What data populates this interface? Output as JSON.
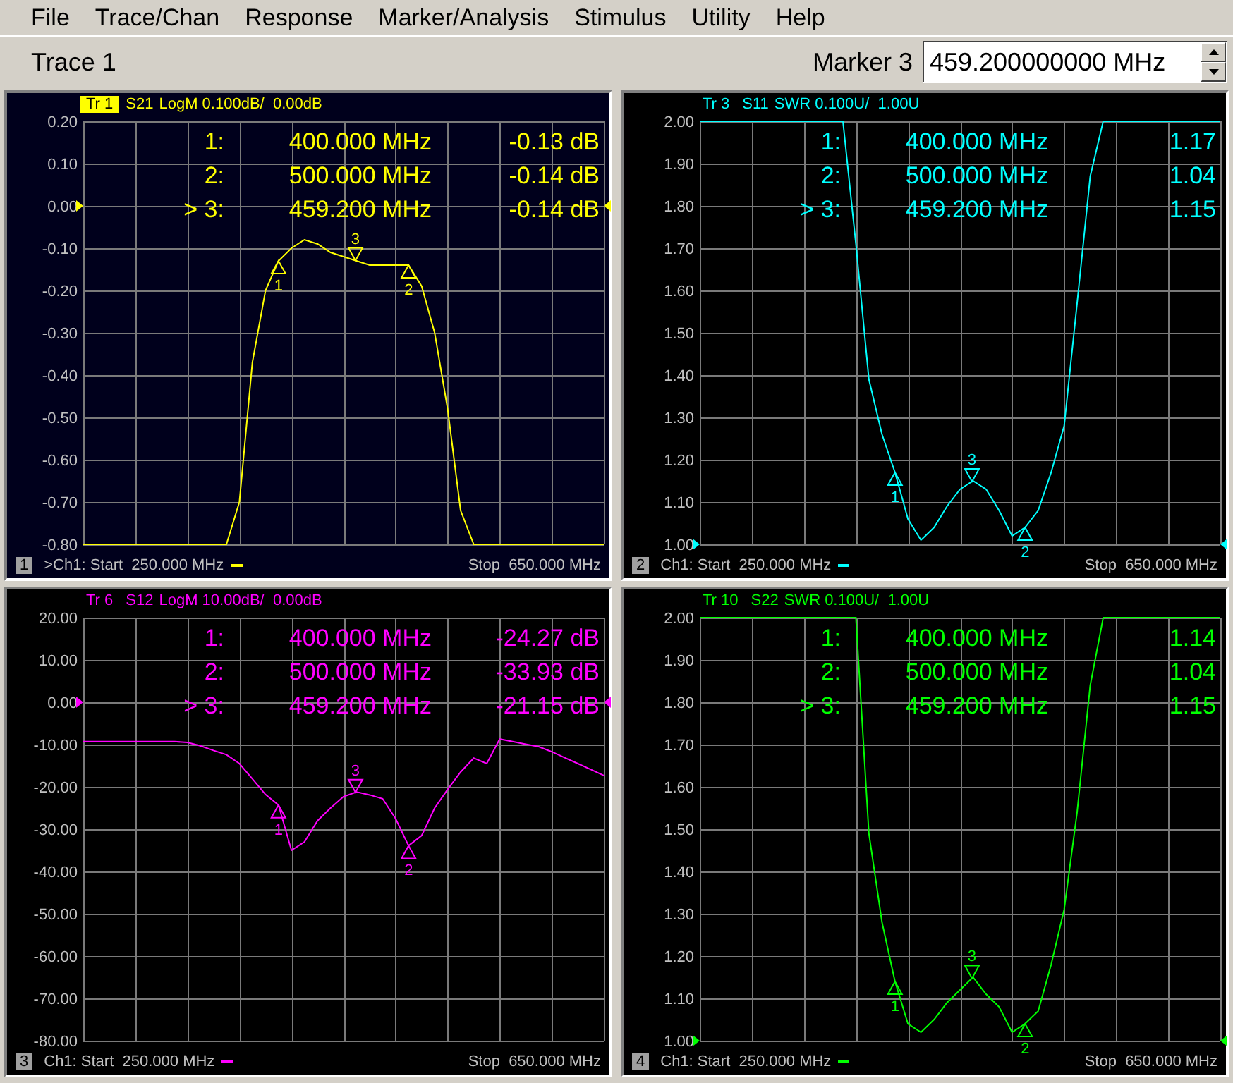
{
  "menu": [
    "File",
    "Trace/Chan",
    "Response",
    "Marker/Analysis",
    "Stimulus",
    "Utility",
    "Help"
  ],
  "toolbar": {
    "trace": "Trace 1",
    "marker_label": "Marker 3",
    "marker_value": "459.200000000 MHz"
  },
  "panels": [
    {
      "number": "1",
      "selected": true,
      "trace_label": "Tr 1",
      "format": "LogM 0.100dB/  0.00dB",
      "chart_data": {
        "type": "line",
        "categories": [
          null,
          null,
          null,
          null,
          null,
          null,
          null,
          null,
          null,
          null,
          null,
          null,
          null,
          null,
          null,
          null,
          null,
          null,
          null,
          null,
          null,
          null,
          null,
          null,
          null,
          null,
          null,
          null,
          null,
          null,
          null,
          null,
          null,
          null,
          null,
          null,
          null,
          null,
          null,
          null,
          null
        ],
        "series": [
          {
            "name": "S21",
            "color": "#ffff00",
            "values": [
              -0.8,
              -0.8,
              -0.8,
              -0.8,
              -0.8,
              -0.8,
              -0.8,
              -0.8,
              -0.8,
              -0.8,
              -0.8,
              -0.8,
              -0.7,
              -0.37,
              -0.2,
              -0.13,
              -0.1,
              -0.08,
              -0.09,
              -0.11,
              -0.12,
              -0.13,
              -0.14,
              -0.14,
              -0.14,
              -0.14,
              -0.19,
              -0.3,
              -0.48,
              -0.72,
              -0.8,
              -0.8,
              -0.8,
              -0.8,
              -0.8,
              -0.8,
              -0.8,
              -0.8,
              -0.8,
              -0.8,
              -0.8
            ]
          }
        ],
        "grid": true,
        "ylim": [
          -0.8,
          0.2
        ],
        "yticks": [
          {
            "value": 0.2,
            "label": "0.20"
          },
          {
            "value": 0.1,
            "label": "0.10"
          },
          {
            "value": 0,
            "label": "0.00"
          },
          {
            "value": -0.1,
            "label": "-0.10"
          },
          {
            "value": -0.2,
            "label": "-0.20"
          },
          {
            "value": -0.3,
            "label": "-0.30"
          },
          {
            "value": -0.4,
            "label": "-0.40"
          },
          {
            "value": -0.5,
            "label": "-0.50"
          },
          {
            "value": -0.6,
            "label": "-0.60"
          },
          {
            "value": -0.7,
            "label": "-0.70"
          },
          {
            "value": -0.8,
            "label": "-0.80"
          }
        ]
      },
      "readouts": [
        {
          "label": "1:",
          "freq": "400.000 MHz",
          "value": "-0.13 dB"
        },
        {
          "label": "2:",
          "freq": "500.000 MHz",
          "value": "-0.14 dB"
        },
        {
          "label": "> 3:",
          "freq": "459.200 MHz",
          "value": "-0.14 dB"
        }
      ],
      "plot_markers": [
        {
          "label": "1",
          "kind": "up"
        },
        {
          "label": "2",
          "kind": "up"
        },
        {
          "label": "3",
          "kind": "down"
        }
      ],
      "start": ">Ch1: Start  250.000 MHz",
      "stop": "Stop  650.000 MHz"
    },
    {
      "number": "2",
      "selected": false,
      "trace_label": "Tr 3",
      "format": "SWR 0.100U/  1.00U",
      "chart_data": {
        "type": "line",
        "categories": [
          null,
          null,
          null,
          null,
          null,
          null,
          null,
          null,
          null,
          null,
          null,
          null,
          null,
          null,
          null,
          null,
          null,
          null,
          null,
          null,
          null,
          null,
          null,
          null,
          null,
          null,
          null,
          null,
          null,
          null,
          null,
          null,
          null,
          null,
          null,
          null,
          null,
          null,
          null,
          null,
          null
        ],
        "series": [
          {
            "name": "S11",
            "color": "#00ffff",
            "values": [
              2,
              2,
              2,
              2,
              2,
              2,
              2,
              2,
              2,
              2,
              2,
              2,
              1.71,
              1.39,
              1.26,
              1.17,
              1.06,
              1.01,
              1.04,
              1.09,
              1.13,
              1.15,
              1.13,
              1.08,
              1.02,
              1.04,
              1.08,
              1.17,
              1.28,
              1.57,
              1.87,
              2,
              2,
              2,
              2,
              2,
              2,
              2,
              2,
              2,
              2
            ]
          }
        ],
        "grid": true,
        "ylim": [
          1,
          2
        ],
        "yticks": [
          {
            "value": 2,
            "label": "2.00"
          },
          {
            "value": 1.9,
            "label": "1.90"
          },
          {
            "value": 1.8,
            "label": "1.80"
          },
          {
            "value": 1.7,
            "label": "1.70"
          },
          {
            "value": 1.6,
            "label": "1.60"
          },
          {
            "value": 1.5,
            "label": "1.50"
          },
          {
            "value": 1.4,
            "label": "1.40"
          },
          {
            "value": 1.3,
            "label": "1.30"
          },
          {
            "value": 1.2,
            "label": "1.20"
          },
          {
            "value": 1.1,
            "label": "1.10"
          },
          {
            "value": 1,
            "label": "1.00"
          }
        ]
      },
      "readouts": [
        {
          "label": "1:",
          "freq": "400.000 MHz",
          "value": "1.17"
        },
        {
          "label": "2:",
          "freq": "500.000 MHz",
          "value": "1.04"
        },
        {
          "label": "> 3:",
          "freq": "459.200 MHz",
          "value": "1.15"
        }
      ],
      "plot_markers": [
        {
          "label": "1",
          "kind": "up"
        },
        {
          "label": "2",
          "kind": "up"
        },
        {
          "label": "3",
          "kind": "down"
        }
      ],
      "start": "Ch1: Start  250.000 MHz",
      "stop": "Stop  650.000 MHz"
    },
    {
      "number": "3",
      "selected": false,
      "trace_label": "Tr 6",
      "format": "LogM 10.00dB/  0.00dB",
      "chart_data": {
        "type": "line",
        "categories": [
          null,
          null,
          null,
          null,
          null,
          null,
          null,
          null,
          null,
          null,
          null,
          null,
          null,
          null,
          null,
          null,
          null,
          null,
          null,
          null,
          null,
          null,
          null,
          null,
          null,
          null,
          null,
          null,
          null,
          null,
          null,
          null,
          null,
          null,
          null,
          null,
          null,
          null,
          null,
          null,
          null
        ],
        "series": [
          {
            "name": "S12",
            "color": "#ff00ff",
            "values": [
              -9.3,
              -9.3,
              -9.3,
              -9.3,
              -9.3,
              -9.3,
              -9.3,
              -9.3,
              -9.5,
              -10.3,
              -11.4,
              -12.4,
              -14.5,
              -18.1,
              -21.8,
              -24.3,
              -35,
              -33,
              -28,
              -25,
              -22.3,
              -21.2,
              -21.9,
              -22.8,
              -27.5,
              -33.9,
              -31.5,
              -25,
              -20.6,
              -16.5,
              -13.2,
              -14.5,
              -8.7,
              -9.3,
              -9.9,
              -10.5,
              -11.7,
              -13.1,
              -14.5,
              -15.9,
              -17.3
            ]
          }
        ],
        "grid": true,
        "ylim": [
          -80,
          20
        ],
        "yticks": [
          {
            "value": 20,
            "label": "20.00"
          },
          {
            "value": 10,
            "label": "10.00"
          },
          {
            "value": 0,
            "label": "0.00"
          },
          {
            "value": -10,
            "label": "-10.00"
          },
          {
            "value": -20,
            "label": "-20.00"
          },
          {
            "value": -30,
            "label": "-30.00"
          },
          {
            "value": -40,
            "label": "-40.00"
          },
          {
            "value": -50,
            "label": "-50.00"
          },
          {
            "value": -60,
            "label": "-60.00"
          },
          {
            "value": -70,
            "label": "-70.00"
          },
          {
            "value": -80,
            "label": "-80.00"
          }
        ]
      },
      "readouts": [
        {
          "label": "1:",
          "freq": "400.000 MHz",
          "value": "-24.27 dB"
        },
        {
          "label": "2:",
          "freq": "500.000 MHz",
          "value": "-33.93 dB"
        },
        {
          "label": "> 3:",
          "freq": "459.200 MHz",
          "value": "-21.15 dB"
        }
      ],
      "plot_markers": [
        {
          "label": "1",
          "kind": "up"
        },
        {
          "label": "2",
          "kind": "up"
        },
        {
          "label": "3",
          "kind": "down"
        }
      ],
      "start": "Ch1: Start  250.000 MHz",
      "stop": "Stop  650.000 MHz"
    },
    {
      "number": "4",
      "selected": false,
      "trace_label": "Tr 10",
      "format": "SWR 0.100U/  1.00U",
      "chart_data": {
        "type": "line",
        "categories": [
          null,
          null,
          null,
          null,
          null,
          null,
          null,
          null,
          null,
          null,
          null,
          null,
          null,
          null,
          null,
          null,
          null,
          null,
          null,
          null,
          null,
          null,
          null,
          null,
          null,
          null,
          null,
          null,
          null,
          null,
          null,
          null,
          null,
          null,
          null,
          null,
          null,
          null,
          null,
          null,
          null
        ],
        "series": [
          {
            "name": "S22",
            "color": "#00ff00",
            "values": [
              2,
              2,
              2,
              2,
              2,
              2,
              2,
              2,
              2,
              2,
              2,
              2,
              2,
              1.49,
              1.28,
              1.14,
              1.04,
              1.02,
              1.05,
              1.09,
              1.12,
              1.15,
              1.11,
              1.08,
              1.02,
              1.04,
              1.07,
              1.18,
              1.31,
              1.54,
              1.84,
              2,
              2,
              2,
              2,
              2,
              2,
              2,
              2,
              2,
              2
            ]
          }
        ],
        "grid": true,
        "ylim": [
          1,
          2
        ],
        "yticks": [
          {
            "value": 2,
            "label": "2.00"
          },
          {
            "value": 1.9,
            "label": "1.90"
          },
          {
            "value": 1.8,
            "label": "1.80"
          },
          {
            "value": 1.7,
            "label": "1.70"
          },
          {
            "value": 1.6,
            "label": "1.60"
          },
          {
            "value": 1.5,
            "label": "1.50"
          },
          {
            "value": 1.4,
            "label": "1.40"
          },
          {
            "value": 1.3,
            "label": "1.30"
          },
          {
            "value": 1.2,
            "label": "1.20"
          },
          {
            "value": 1.1,
            "label": "1.10"
          },
          {
            "value": 1,
            "label": "1.00"
          }
        ]
      },
      "readouts": [
        {
          "label": "1:",
          "freq": "400.000 MHz",
          "value": "1.14"
        },
        {
          "label": "2:",
          "freq": "500.000 MHz",
          "value": "1.04"
        },
        {
          "label": "> 3:",
          "freq": "459.200 MHz",
          "value": "1.15"
        }
      ],
      "plot_markers": [
        {
          "label": "1",
          "kind": "up"
        },
        {
          "label": "2",
          "kind": "up"
        },
        {
          "label": "3",
          "kind": "down"
        }
      ],
      "start": "Ch1: Start  250.000 MHz",
      "stop": "Stop  650.000 MHz"
    }
  ]
}
